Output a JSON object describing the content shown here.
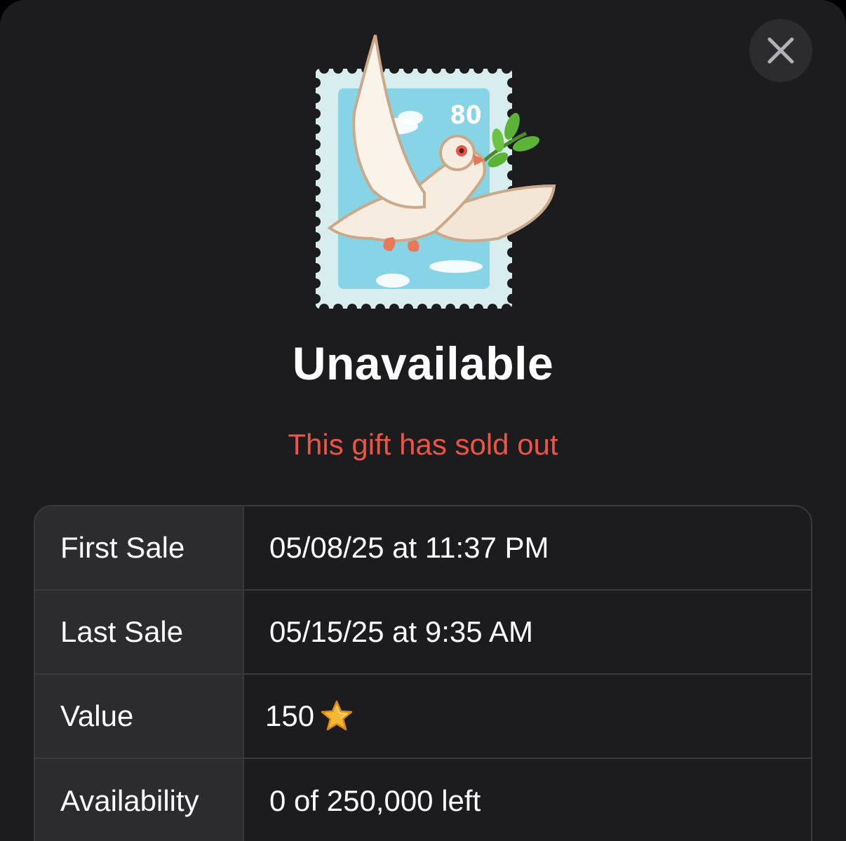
{
  "header": {
    "close_icon": "close-icon"
  },
  "gift": {
    "stamp_denomination": "80",
    "title": "Unavailable",
    "status": "This gift has sold out",
    "status_color": "#eb5545"
  },
  "details": {
    "rows": [
      {
        "label": "First Sale",
        "value": "05/08/25 at 11:37 PM"
      },
      {
        "label": "Last Sale",
        "value": "05/15/25 at 9:35 AM"
      },
      {
        "label": "Value",
        "value": "150",
        "icon": "star-icon"
      },
      {
        "label": "Availability",
        "value": "0 of 250,000 left"
      }
    ]
  },
  "colors": {
    "sheet_background": "#1c1c1e",
    "label_cell_background": "#2c2c2e",
    "border": "#3a3a3c",
    "star": "#f5b731"
  }
}
